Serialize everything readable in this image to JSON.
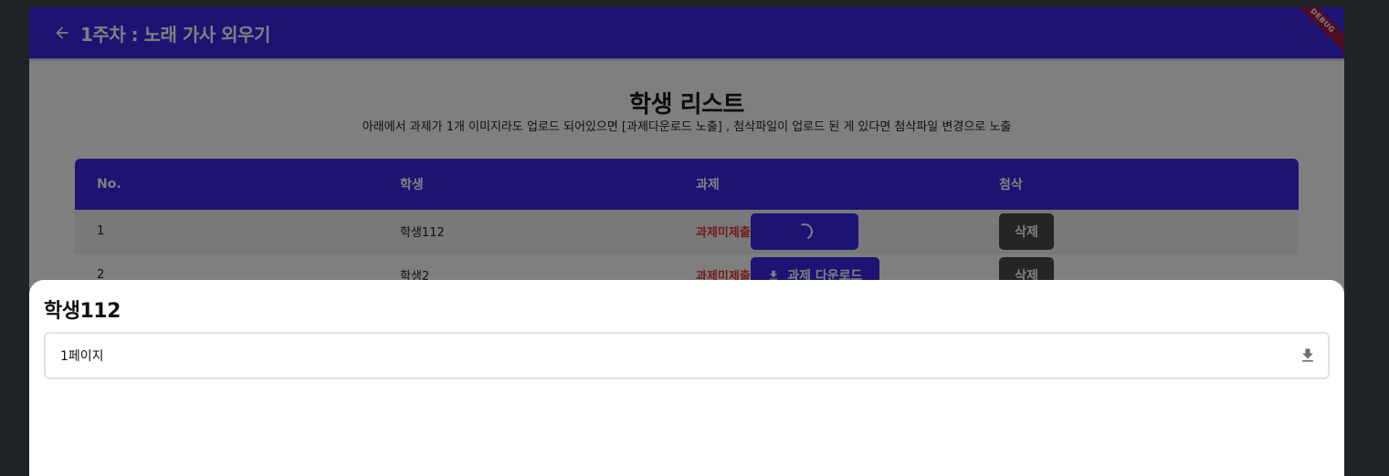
{
  "appbar": {
    "title": "1주차 : 노래 가사 외우기",
    "back_icon": "arrow-left-icon",
    "debug_label": "DEBUG"
  },
  "page": {
    "title": "학생 리스트",
    "subtitle": "아래에서 과제가 1개 이미지라도 업로드 되어있으면 [과제다운로드 노출] , 첨삭파일이 업로드 된 게 있다면 첨삭파일 변경으로 노출"
  },
  "table": {
    "headers": [
      "No.",
      "학생",
      "과제",
      "첨삭"
    ],
    "rows": [
      {
        "no": "1",
        "student": "학생112",
        "status": "과제미제출",
        "action": "loading",
        "delete_label": "삭제"
      },
      {
        "no": "2",
        "student": "학생2",
        "status": "과제미제출",
        "action": "download",
        "download_label": "과제 다운로드",
        "delete_label": "삭제"
      }
    ]
  },
  "sheet": {
    "title": "학생112",
    "items": [
      {
        "label": "1페이지",
        "icon": "download-icon"
      }
    ]
  },
  "colors": {
    "primary": "#3a27e6",
    "danger_text": "#e53935",
    "delete_button": "#474a4d",
    "debug_ribbon": "#a01846"
  }
}
